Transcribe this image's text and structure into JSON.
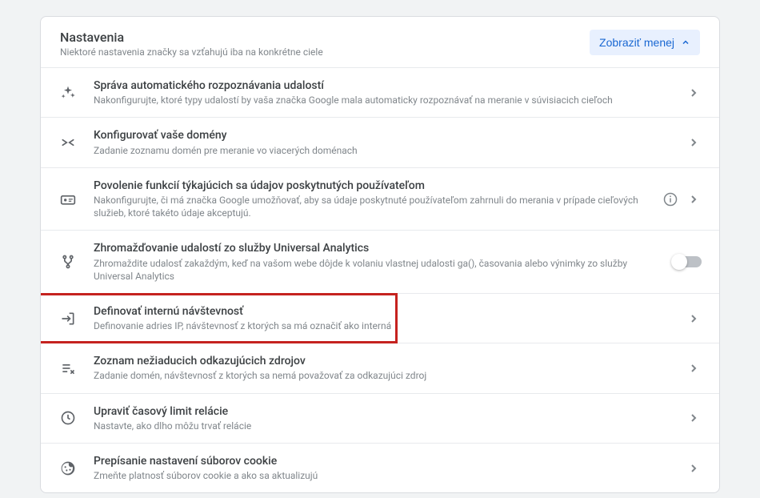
{
  "header": {
    "title": "Nastavenia",
    "subtitle": "Niektoré nastavenia značky sa vzťahujú iba na konkrétne ciele",
    "collapse_label": "Zobraziť menej"
  },
  "rows": {
    "auto_events": {
      "title": "Správa automatického rozpoznávania udalostí",
      "desc": "Nakonfigurujte, ktoré typy udalostí by vaša značka Google mala automaticky rozpoznávať na meranie v súvisiacich cieľoch"
    },
    "domains": {
      "title": "Konfigurovať vaše domény",
      "desc": "Zadanie zoznamu domén pre meranie vo viacerých doménach"
    },
    "user_data": {
      "title": "Povolenie funkcií týkajúcich sa údajov poskytnutých používateľom",
      "desc": "Nakonfigurujte, či má značka Google umožňovať, aby sa údaje poskytnuté používateľom zahrnuli do merania v prípade cieľových služieb, ktoré takéto údaje akceptujú."
    },
    "ua_events": {
      "title": "Zhromažďovanie udalostí zo služby Universal Analytics",
      "desc": "Zhromaždite udalosť zakaždým, keď na vašom webe dôjde k volaniu vlastnej udalosti ga(), časovania alebo výnimky zo služby Universal Analytics"
    },
    "internal_traffic": {
      "title": "Definovať internú návštevnosť",
      "desc": "Definovanie adries IP, návštevnosť z ktorých sa má označiť ako interná"
    },
    "referrals": {
      "title": "Zoznam nežiaducich odkazujúcich zdrojov",
      "desc": "Zadanie domén, návštevnosť z ktorých sa nemá považovať za odkazujúci zdroj"
    },
    "session_timeout": {
      "title": "Upraviť časový limit relácie",
      "desc": "Nastavte, ako dlho môžu trvať relácie"
    },
    "cookies": {
      "title": "Prepísanie nastavení súborov cookie",
      "desc": "Zmeňte platnosť súborov cookie a ako sa aktualizujú"
    }
  }
}
